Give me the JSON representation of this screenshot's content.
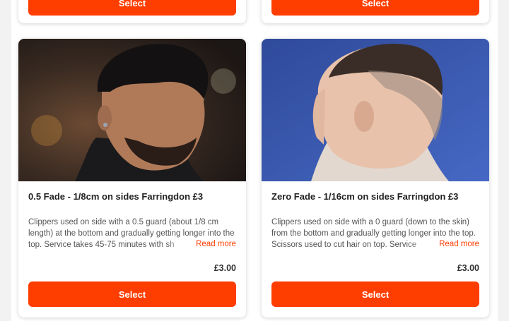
{
  "cards_top": [
    {
      "select_label": "Select"
    },
    {
      "select_label": "Select"
    }
  ],
  "services": [
    {
      "image_icon": "barber-photo-fade",
      "title": "0.5 Fade - 1/8cm on sides Farringdon £3",
      "description": "Clippers used on side with a 0.5 guard (about 1/8 cm length) at the bottom and gradually getting longer into the top. Service takes 45-75 minutes with sh",
      "read_more": "Read more",
      "price": "£3.00",
      "select_label": "Select"
    },
    {
      "image_icon": "barber-photo-zero-fade",
      "title": "Zero Fade - 1/16cm on sides Farringdon £3",
      "description": "Clippers used on side with a 0 guard (down to the skin) from the bottom and gradually getting longer into the top. Scissors used to cut hair on top. Service",
      "read_more": "Read more",
      "price": "£3.00",
      "select_label": "Select"
    }
  ],
  "colors": {
    "accent": "#fe3d00",
    "photo1_bg": "#3a2e28",
    "photo2_bg": "#3b5bb5"
  }
}
